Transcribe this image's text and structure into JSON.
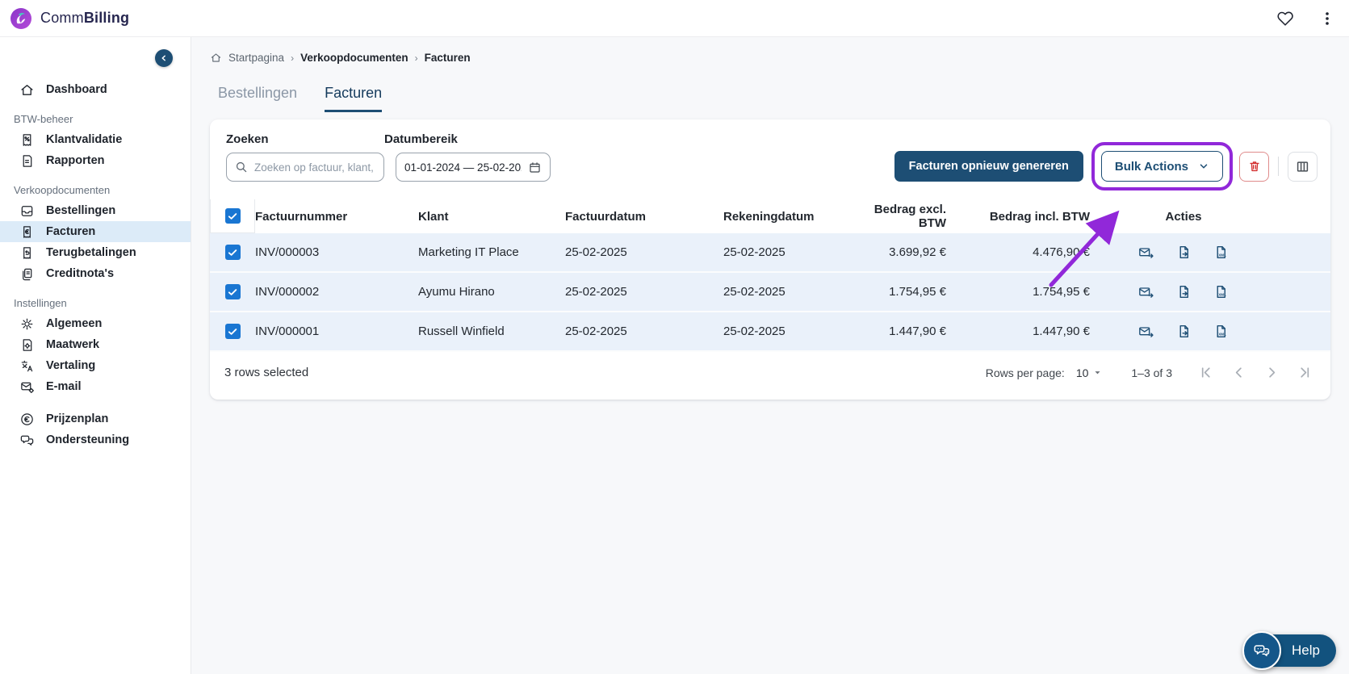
{
  "brand": {
    "name_regular": "Comm",
    "name_bold": "Billing"
  },
  "sidebar": {
    "groups": [
      {
        "items": [
          {
            "label": "Dashboard"
          }
        ]
      },
      {
        "label": "BTW-beheer",
        "items": [
          {
            "label": "Klantvalidatie"
          },
          {
            "label": "Rapporten"
          }
        ]
      },
      {
        "label": "Verkoopdocumenten",
        "items": [
          {
            "label": "Bestellingen"
          },
          {
            "label": "Facturen",
            "active": true
          },
          {
            "label": "Terugbetalingen"
          },
          {
            "label": "Creditnota's"
          }
        ]
      },
      {
        "label": "Instellingen",
        "items": [
          {
            "label": "Algemeen"
          },
          {
            "label": "Maatwerk"
          },
          {
            "label": "Vertaling"
          },
          {
            "label": "E-mail"
          }
        ]
      },
      {
        "items": [
          {
            "label": "Prijzenplan"
          },
          {
            "label": "Ondersteuning"
          }
        ]
      }
    ]
  },
  "breadcrumb": {
    "items": [
      "Startpagina",
      "Verkoopdocumenten",
      "Facturen"
    ],
    "separator": "›"
  },
  "tabs": [
    {
      "label": "Bestellingen"
    },
    {
      "label": "Facturen",
      "active": true
    }
  ],
  "filters": {
    "search_label": "Zoeken",
    "search_placeholder": "Zoeken op factuur, klant,",
    "date_label": "Datumbereik",
    "date_value": "01-01-2024 — 25-02-202"
  },
  "toolbar": {
    "regenerate_label": "Facturen opnieuw genereren",
    "bulk_actions_label": "Bulk Actions"
  },
  "table": {
    "headers": [
      "Factuurnummer",
      "Klant",
      "Factuurdatum",
      "Rekeningdatum",
      "Bedrag excl. BTW",
      "Bedrag incl. BTW",
      "Acties"
    ],
    "rows": [
      {
        "invoice": "INV/000003",
        "client": "Marketing IT Place",
        "invoice_date": "25-02-2025",
        "billing_date": "25-02-2025",
        "amount_excl": "3.699,92 €",
        "amount_incl": "4.476,90 €"
      },
      {
        "invoice": "INV/000002",
        "client": "Ayumu Hirano",
        "invoice_date": "25-02-2025",
        "billing_date": "25-02-2025",
        "amount_excl": "1.754,95 €",
        "amount_incl": "1.754,95 €"
      },
      {
        "invoice": "INV/000001",
        "client": "Russell Winfield",
        "invoice_date": "25-02-2025",
        "billing_date": "25-02-2025",
        "amount_excl": "1.447,90 €",
        "amount_incl": "1.447,90 €"
      }
    ],
    "footer": {
      "selected_text": "3 rows selected",
      "rows_per_page_label": "Rows per page:",
      "rows_per_page_value": "10",
      "range_text": "1–3 of 3"
    }
  },
  "help": {
    "label": "Help"
  },
  "colors": {
    "primary": "#1d4e74",
    "annotation": "#9128d9",
    "danger": "#d32f2f",
    "checkbox": "#1976d2",
    "selected_row": "#eaf1fa",
    "active_nav": "#dcebf8",
    "help_bg": "#12527e"
  }
}
